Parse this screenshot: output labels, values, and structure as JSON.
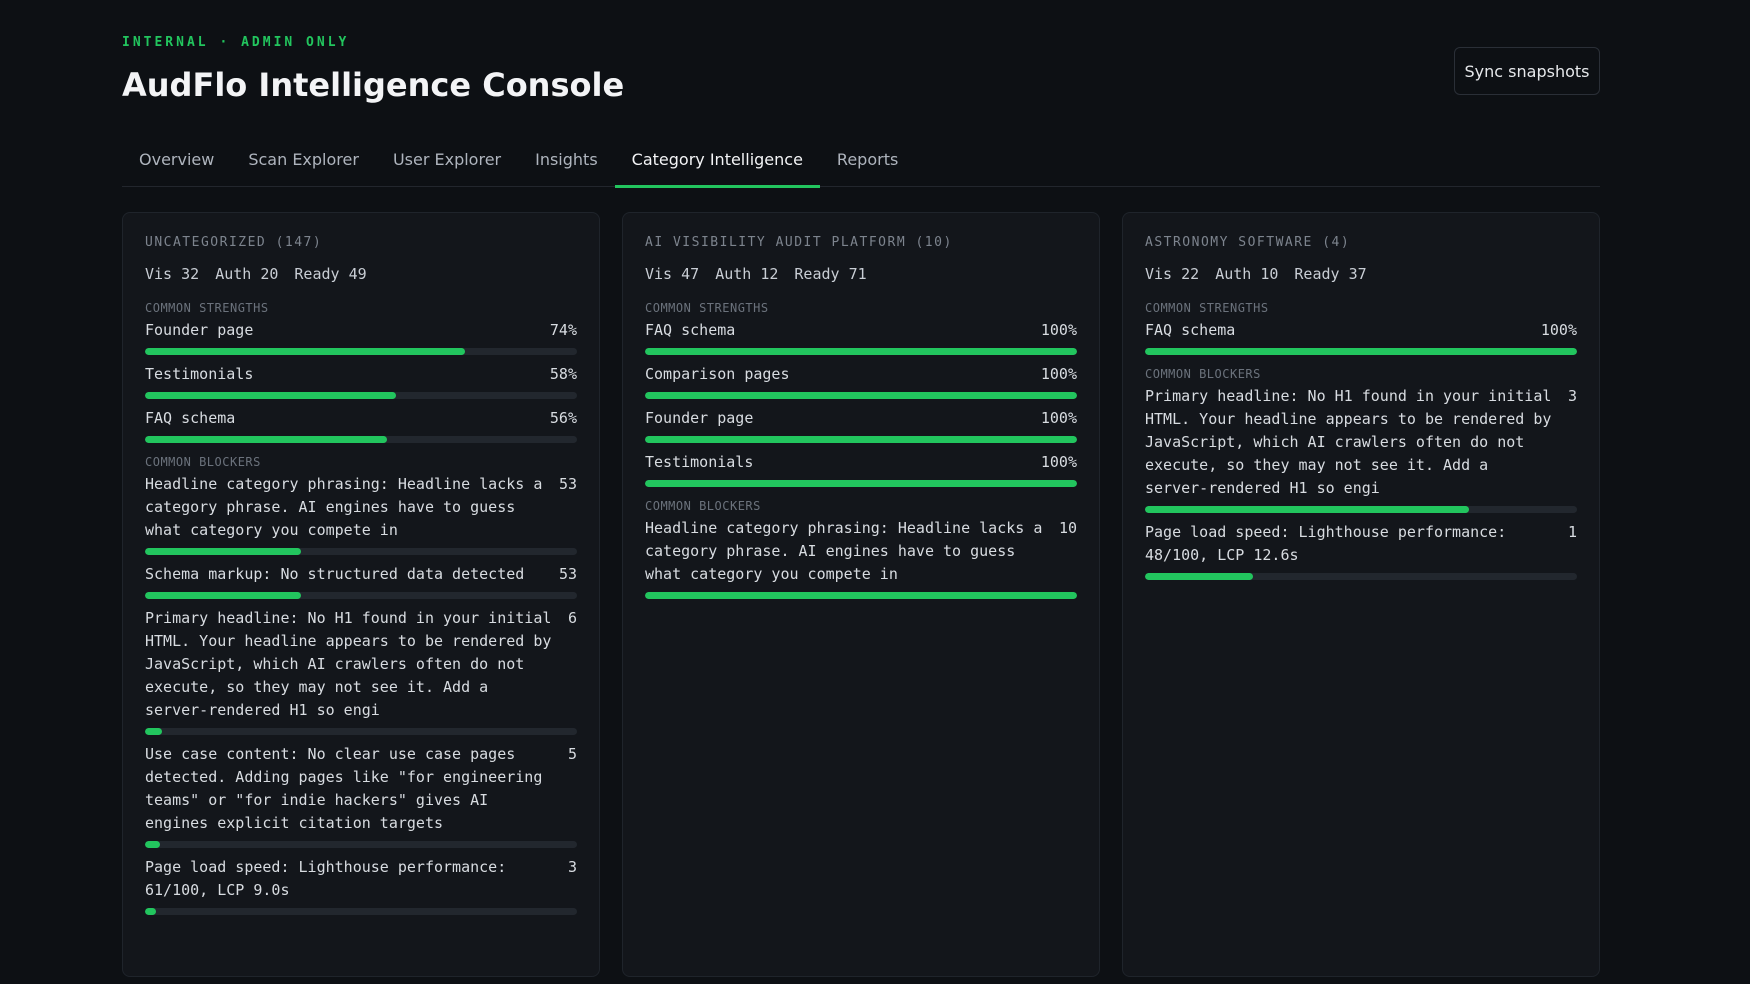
{
  "header": {
    "eyebrow": "INTERNAL · ADMIN ONLY",
    "title": "AudFlo Intelligence Console",
    "sync_label": "Sync snapshots"
  },
  "tabs": [
    {
      "label": "Overview",
      "active": false
    },
    {
      "label": "Scan Explorer",
      "active": false
    },
    {
      "label": "User Explorer",
      "active": false
    },
    {
      "label": "Insights",
      "active": false
    },
    {
      "label": "Category Intelligence",
      "active": true
    },
    {
      "label": "Reports",
      "active": false
    }
  ],
  "labels": {
    "strengths": "COMMON STRENGTHS",
    "blockers": "COMMON BLOCKERS"
  },
  "colors": {
    "accent": "#22c55e",
    "background": "#0d1014",
    "card": "#13161b"
  },
  "cards": [
    {
      "title": "UNCATEGORIZED (147)",
      "stats": [
        "Vis 32",
        "Auth 20",
        "Ready 49"
      ],
      "strengths": [
        {
          "label": "Founder page",
          "value": "74%",
          "fill": 0.74
        },
        {
          "label": "Testimonials",
          "value": "58%",
          "fill": 0.58
        },
        {
          "label": "FAQ schema",
          "value": "56%",
          "fill": 0.56
        }
      ],
      "blockers": [
        {
          "label": "Headline category phrasing: Headline lacks a category phrase. AI engines have to guess what category you compete in",
          "value": "53",
          "fill": 0.36
        },
        {
          "label": "Schema markup: No structured data detected",
          "value": "53",
          "fill": 0.36
        },
        {
          "label": "Primary headline: No H1 found in your initial HTML. Your headline appears to be rendered by JavaScript, which AI crawlers often do not execute, so they may not see it. Add a server-rendered H1 so engi",
          "value": "6",
          "fill": 0.04
        },
        {
          "label": "Use case content: No clear use case pages detected. Adding pages like \"for engineering teams\" or \"for indie hackers\" gives AI engines explicit citation targets",
          "value": "5",
          "fill": 0.034
        },
        {
          "label": "Page load speed: Lighthouse performance: 61/100, LCP 9.0s",
          "value": "3",
          "fill": 0.02
        }
      ]
    },
    {
      "title": "AI VISIBILITY AUDIT PLATFORM (10)",
      "stats": [
        "Vis 47",
        "Auth 12",
        "Ready 71"
      ],
      "strengths": [
        {
          "label": "FAQ schema",
          "value": "100%",
          "fill": 1.0
        },
        {
          "label": "Comparison pages",
          "value": "100%",
          "fill": 1.0
        },
        {
          "label": "Founder page",
          "value": "100%",
          "fill": 1.0
        },
        {
          "label": "Testimonials",
          "value": "100%",
          "fill": 1.0
        }
      ],
      "blockers": [
        {
          "label": "Headline category phrasing: Headline lacks a category phrase. AI engines have to guess what category you compete in",
          "value": "10",
          "fill": 1.0
        }
      ]
    },
    {
      "title": "ASTRONOMY SOFTWARE (4)",
      "stats": [
        "Vis 22",
        "Auth 10",
        "Ready 37"
      ],
      "strengths": [
        {
          "label": "FAQ schema",
          "value": "100%",
          "fill": 1.0
        }
      ],
      "blockers": [
        {
          "label": "Primary headline: No H1 found in your initial HTML. Your headline appears to be rendered by JavaScript, which AI crawlers often do not execute, so they may not see it. Add a server-rendered H1 so engi",
          "value": "3",
          "fill": 0.75
        },
        {
          "label": "Page load speed: Lighthouse performance: 48/100, LCP 12.6s",
          "value": "1",
          "fill": 0.25
        }
      ]
    }
  ]
}
